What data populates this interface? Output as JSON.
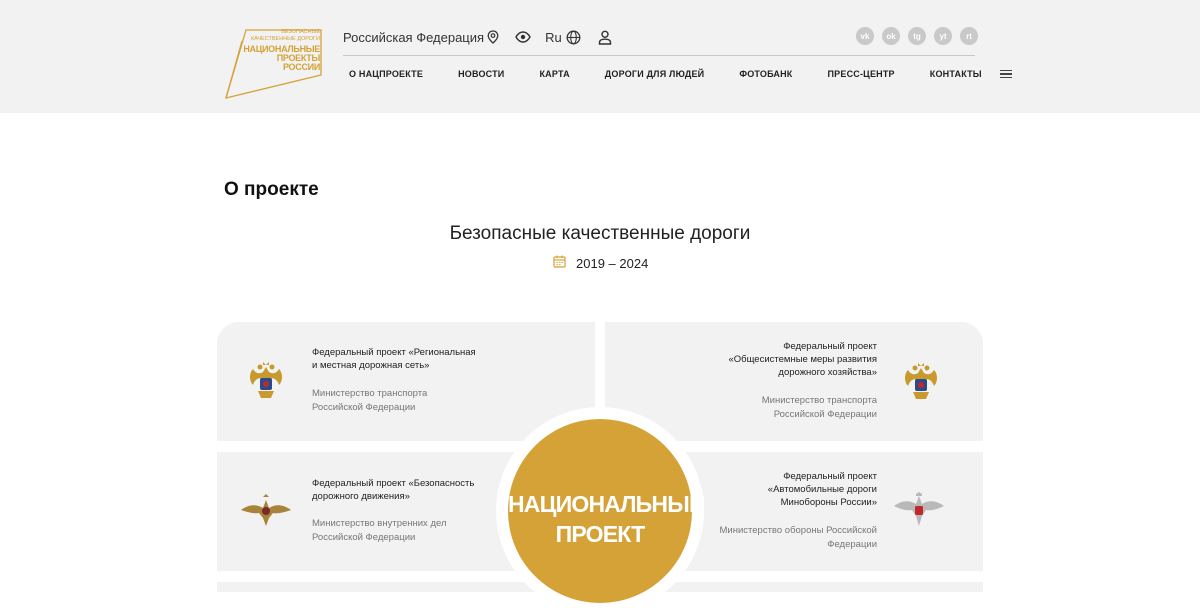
{
  "logo": {
    "line1": "БЕЗОПАСНЫЕ",
    "line2": "КАЧЕСТВЕННЫЕ ДОРОГИ",
    "line3": "НАЦИОНАЛЬНЫЕ",
    "line4": "ПРОЕКТЫ",
    "line5": "РОССИИ"
  },
  "topbar": {
    "region": "Российская Федерация",
    "lang": "Ru"
  },
  "socials": [
    {
      "label": "vk",
      "icon": "vk-icon"
    },
    {
      "label": "ok",
      "icon": "odnoklassniki-icon"
    },
    {
      "label": "tg",
      "icon": "telegram-icon"
    },
    {
      "label": "yt",
      "icon": "video-icon"
    },
    {
      "label": "rt",
      "icon": "rutube-icon"
    }
  ],
  "nav": [
    "О НАЦПРОЕКТЕ",
    "НОВОСТИ",
    "КАРТА",
    "ДОРОГИ ДЛЯ ЛЮДЕЙ",
    "ФОТОБАНК",
    "ПРЕСС-ЦЕНТР",
    "КОНТАКТЫ"
  ],
  "page": {
    "heading": "О проекте",
    "project_title": "Безопасные качественные дороги",
    "years": "2019 – 2024"
  },
  "cards": [
    {
      "title_line1": "Федеральный проект «Региональная",
      "title_line2": "и местная дорожная сеть»",
      "ministry_line1": "Министерство транспорта",
      "ministry_line2": "Российской Федерации"
    },
    {
      "title_line1": "Федеральный проект",
      "title_line2": "«Общесистемные меры развития",
      "title_line3": "дорожного хозяйства»",
      "ministry_line1": "Министерство транспорта",
      "ministry_line2": "Российской Федерации"
    },
    {
      "title_line1": "Федеральный проект «Безопасность",
      "title_line2": "дорожного движения»",
      "ministry_line1": "Министерство внутренних дел",
      "ministry_line2": "Российской Федерации"
    },
    {
      "title_line1": "Федеральный проект",
      "title_line2": "«Автомобильные дороги",
      "title_line3": "Минобороны России»",
      "ministry_line1": "Министерство обороны Российской",
      "ministry_line2": "Федерации"
    }
  ],
  "center": {
    "line1": "НАЦИОНАЛЬНЫЙ",
    "line2": "ПРОЕКТ"
  },
  "colors": {
    "gold": "#d4a237",
    "header_bg": "#f2f2f2",
    "card_bg": "#f2f2f2"
  }
}
